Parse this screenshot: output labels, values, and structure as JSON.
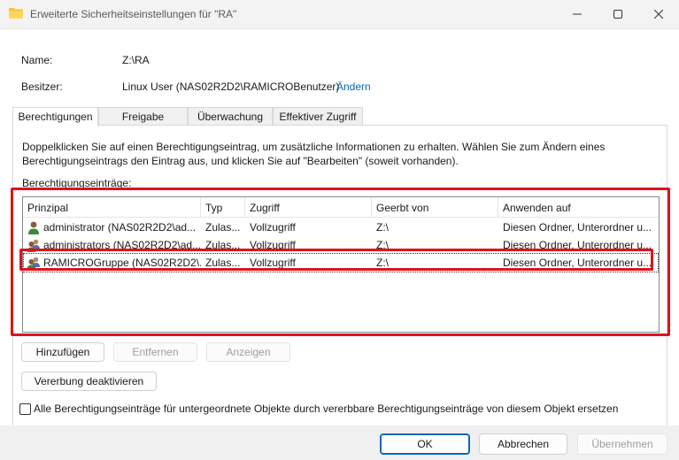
{
  "window": {
    "title": "Erweiterte Sicherheitseinstellungen für \"RA\""
  },
  "info": {
    "name_label": "Name:",
    "name_value": "Z:\\RA",
    "owner_label": "Besitzer:",
    "owner_value": "Linux User (NAS02R2D2\\RAMICROBenutzer)",
    "owner_change_link": "Ändern"
  },
  "tabs": [
    {
      "label": "Berechtigungen"
    },
    {
      "label": "Freigabe"
    },
    {
      "label": "Überwachung"
    },
    {
      "label": "Effektiver Zugriff"
    }
  ],
  "panel": {
    "description": "Doppelklicken Sie auf einen Berechtigungseintrag, um zusätzliche Informationen zu erhalten. Wählen Sie zum Ändern eines Berechtigungseintrags den Eintrag aus, und klicken Sie auf \"Bearbeiten\" (soweit vorhanden).",
    "entries_caption": "Berechtigungseinträge:"
  },
  "list": {
    "columns": [
      "Prinzipal",
      "Typ",
      "Zugriff",
      "Geerbt von",
      "Anwenden auf"
    ],
    "rows": [
      {
        "principal": "administrator (NAS02R2D2\\ad...",
        "type": "Zulas...",
        "access": "Vollzugriff",
        "inherited": "Z:\\",
        "applies": "Diesen Ordner, Unterordner u...",
        "icon": "user-icon"
      },
      {
        "principal": "administrators (NAS02R2D2\\ad...",
        "type": "Zulas...",
        "access": "Vollzugriff",
        "inherited": "Z:\\",
        "applies": "Diesen Ordner, Unterordner u...",
        "icon": "group-icon"
      },
      {
        "principal": "RAMICROGruppe (NAS02R2D2\\...",
        "type": "Zulas...",
        "access": "Vollzugriff",
        "inherited": "Z:\\",
        "applies": "Diesen Ordner, Unterordner u...",
        "icon": "group-icon"
      }
    ]
  },
  "buttons": {
    "add": "Hinzufügen",
    "remove": "Entfernen",
    "view": "Anzeigen",
    "disable_inheritance": "Vererbung deaktivieren",
    "ok": "OK",
    "cancel": "Abbrechen",
    "apply": "Übernehmen"
  },
  "replace_checkbox": {
    "label": "Alle Berechtigungseinträge für untergeordnete Objekte durch vererbbare Berechtigungseinträge von diesem Objekt ersetzen",
    "checked": false
  },
  "colors": {
    "highlight_red": "#e0121b",
    "link_blue": "#0067c0"
  }
}
